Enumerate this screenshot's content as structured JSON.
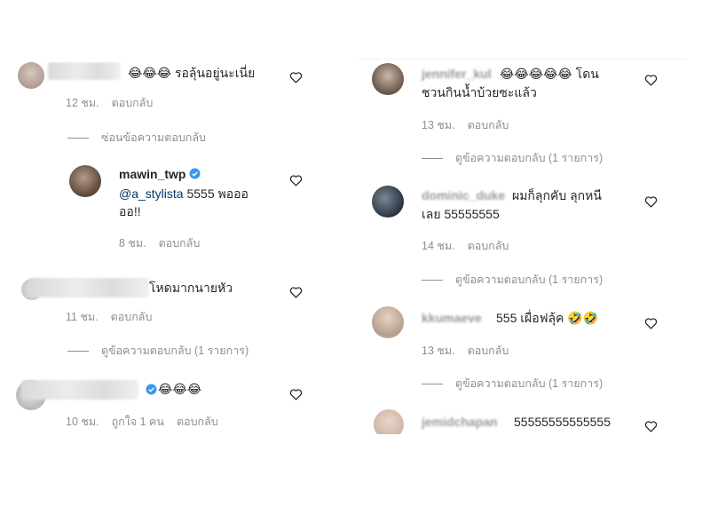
{
  "left": {
    "comments": [
      {
        "text": "😂😂😂 รอลุ้นอยู่นะเนี่ย",
        "time": "12 ชม.",
        "reply": "ตอบกลับ",
        "toggle": "ซ่อนข้อความตอบกลับ"
      },
      {
        "username": "mawin_twp",
        "mention": "@a_stylista",
        "text_line1": " 5555 พอออ",
        "text_line2": "ออ!!",
        "time": "8 ชม.",
        "reply": "ตอบกลับ"
      },
      {
        "text": "โหดมากนายหัว",
        "time": "11 ชม.",
        "reply": "ตอบกลับ",
        "toggle": "ดูข้อความตอบกลับ (1 รายการ)"
      },
      {
        "text": "😂😂😂",
        "time": "10 ชม.",
        "likes": "ถูกใจ 1 คน",
        "reply": "ตอบกลับ"
      }
    ]
  },
  "right": {
    "comments": [
      {
        "username": "jennifer_kul",
        "text_line1": "😂😂😂😂😂 โดน",
        "text_line2": "ชวนกินน้ำบ้วยซะแล้ว",
        "time": "13 ชม.",
        "reply": "ตอบกลับ",
        "toggle": "ดูข้อความตอบกลับ (1 รายการ)"
      },
      {
        "username": "dominic_duke",
        "text_line1": "ผมก็ลุกคับ ลุกหนี",
        "text_line2": "เลย 55555555",
        "time": "14 ชม.",
        "reply": "ตอบกลับ",
        "toggle": "ดูข้อความตอบกลับ (1 รายการ)"
      },
      {
        "username": "kkumaeve",
        "text": "555 เผื่อฟลุ้ค 🤣🤣",
        "time": "13 ชม.",
        "reply": "ตอบกลับ",
        "toggle": "ดูข้อความตอบกลับ (1 รายการ)"
      },
      {
        "username": "jemidchapan",
        "text": "55555555555555"
      }
    ]
  },
  "colors": {
    "text": "#262626",
    "meta": "#8e8e8e",
    "mention": "#00376b",
    "verified": "#3897f0"
  }
}
